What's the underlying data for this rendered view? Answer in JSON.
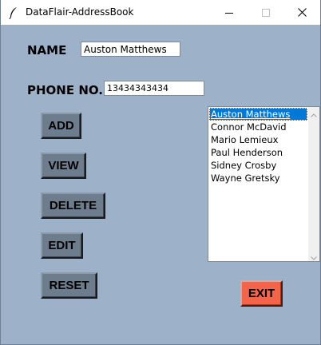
{
  "window": {
    "title": "DataFlair-AddressBook",
    "minimize_icon": "minimize-icon",
    "maximize_icon": "maximize-icon",
    "close_icon": "close-icon",
    "app_icon": "feather-icon"
  },
  "form": {
    "name_label": "NAME",
    "name_value": "Auston Matthews",
    "phone_label": "PHONE NO.",
    "phone_value": "13434343434"
  },
  "buttons": {
    "add": "ADD",
    "view": "VIEW",
    "delete": "DELETE",
    "edit": "EDIT",
    "reset": "RESET",
    "exit": "EXIT"
  },
  "contacts": {
    "items": [
      {
        "label": "Auston Matthews",
        "selected": true
      },
      {
        "label": "Connor McDavid",
        "selected": false
      },
      {
        "label": "Mario Lemieux",
        "selected": false
      },
      {
        "label": "Paul Henderson",
        "selected": false
      },
      {
        "label": "Sidney Crosby",
        "selected": false
      },
      {
        "label": "Wayne Gretsky",
        "selected": false
      }
    ]
  },
  "colors": {
    "background": "#9db1c9",
    "button": "#6e7d8e",
    "exit_button": "#f36449",
    "selection": "#0078d7"
  }
}
